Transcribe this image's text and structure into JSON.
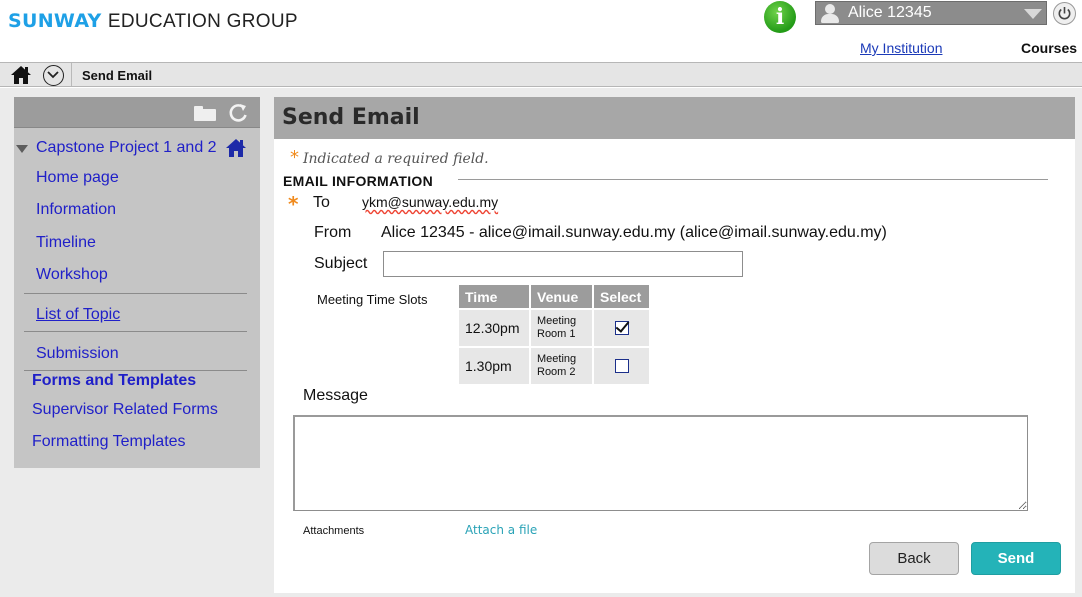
{
  "header": {
    "brand_bold": "SUNWAY",
    "brand_rest": "EDUCATION GROUP",
    "user_name": "Alice 12345",
    "nav_institution": "My Institution",
    "nav_courses": "Courses"
  },
  "breadcrumb": {
    "title": "Send Email"
  },
  "sidebar": {
    "course_title": "Capstone Project 1 and 2",
    "items": [
      {
        "label": "Home page"
      },
      {
        "label": "Information"
      },
      {
        "label": "Timeline"
      },
      {
        "label": "Workshop"
      },
      {
        "label": "List of Topic"
      },
      {
        "label": "Submission"
      }
    ],
    "section_heading": "Forms and Templates",
    "section_items": [
      {
        "label": "Supervisor Related Forms"
      },
      {
        "label": "Formatting Templates"
      }
    ]
  },
  "main": {
    "title": "Send Email",
    "required_note": "Indicated a required field.",
    "section_heading": "EMAIL INFORMATION",
    "to_label": "To",
    "to_value": "ykm@sunway.edu.my",
    "from_label": "From",
    "from_value": "Alice 12345 -  alice@imail.sunway.edu.my (alice@imail.sunway.edu.my)",
    "subject_label": "Subject",
    "subject_value": "",
    "slots_label": "Meeting Time Slots",
    "slots_columns": [
      "Time",
      "Venue",
      "Select"
    ],
    "slots": [
      {
        "time": "12.30pm",
        "venue_line1": "Meeting",
        "venue_line2": "Room 1",
        "selected": true
      },
      {
        "time": "1.30pm",
        "venue_line1": "Meeting",
        "venue_line2": "Room 2",
        "selected": false
      }
    ],
    "message_label": "Message",
    "message_value": "",
    "attachments_label": "Attachments",
    "attach_link": "Attach a file",
    "back_label": "Back",
    "send_label": "Send"
  },
  "colors": {
    "brand_blue": "#1ea0e6",
    "link_blue": "#2020c8",
    "required_orange": "#f08a1c",
    "send_teal": "#24b3b8"
  }
}
